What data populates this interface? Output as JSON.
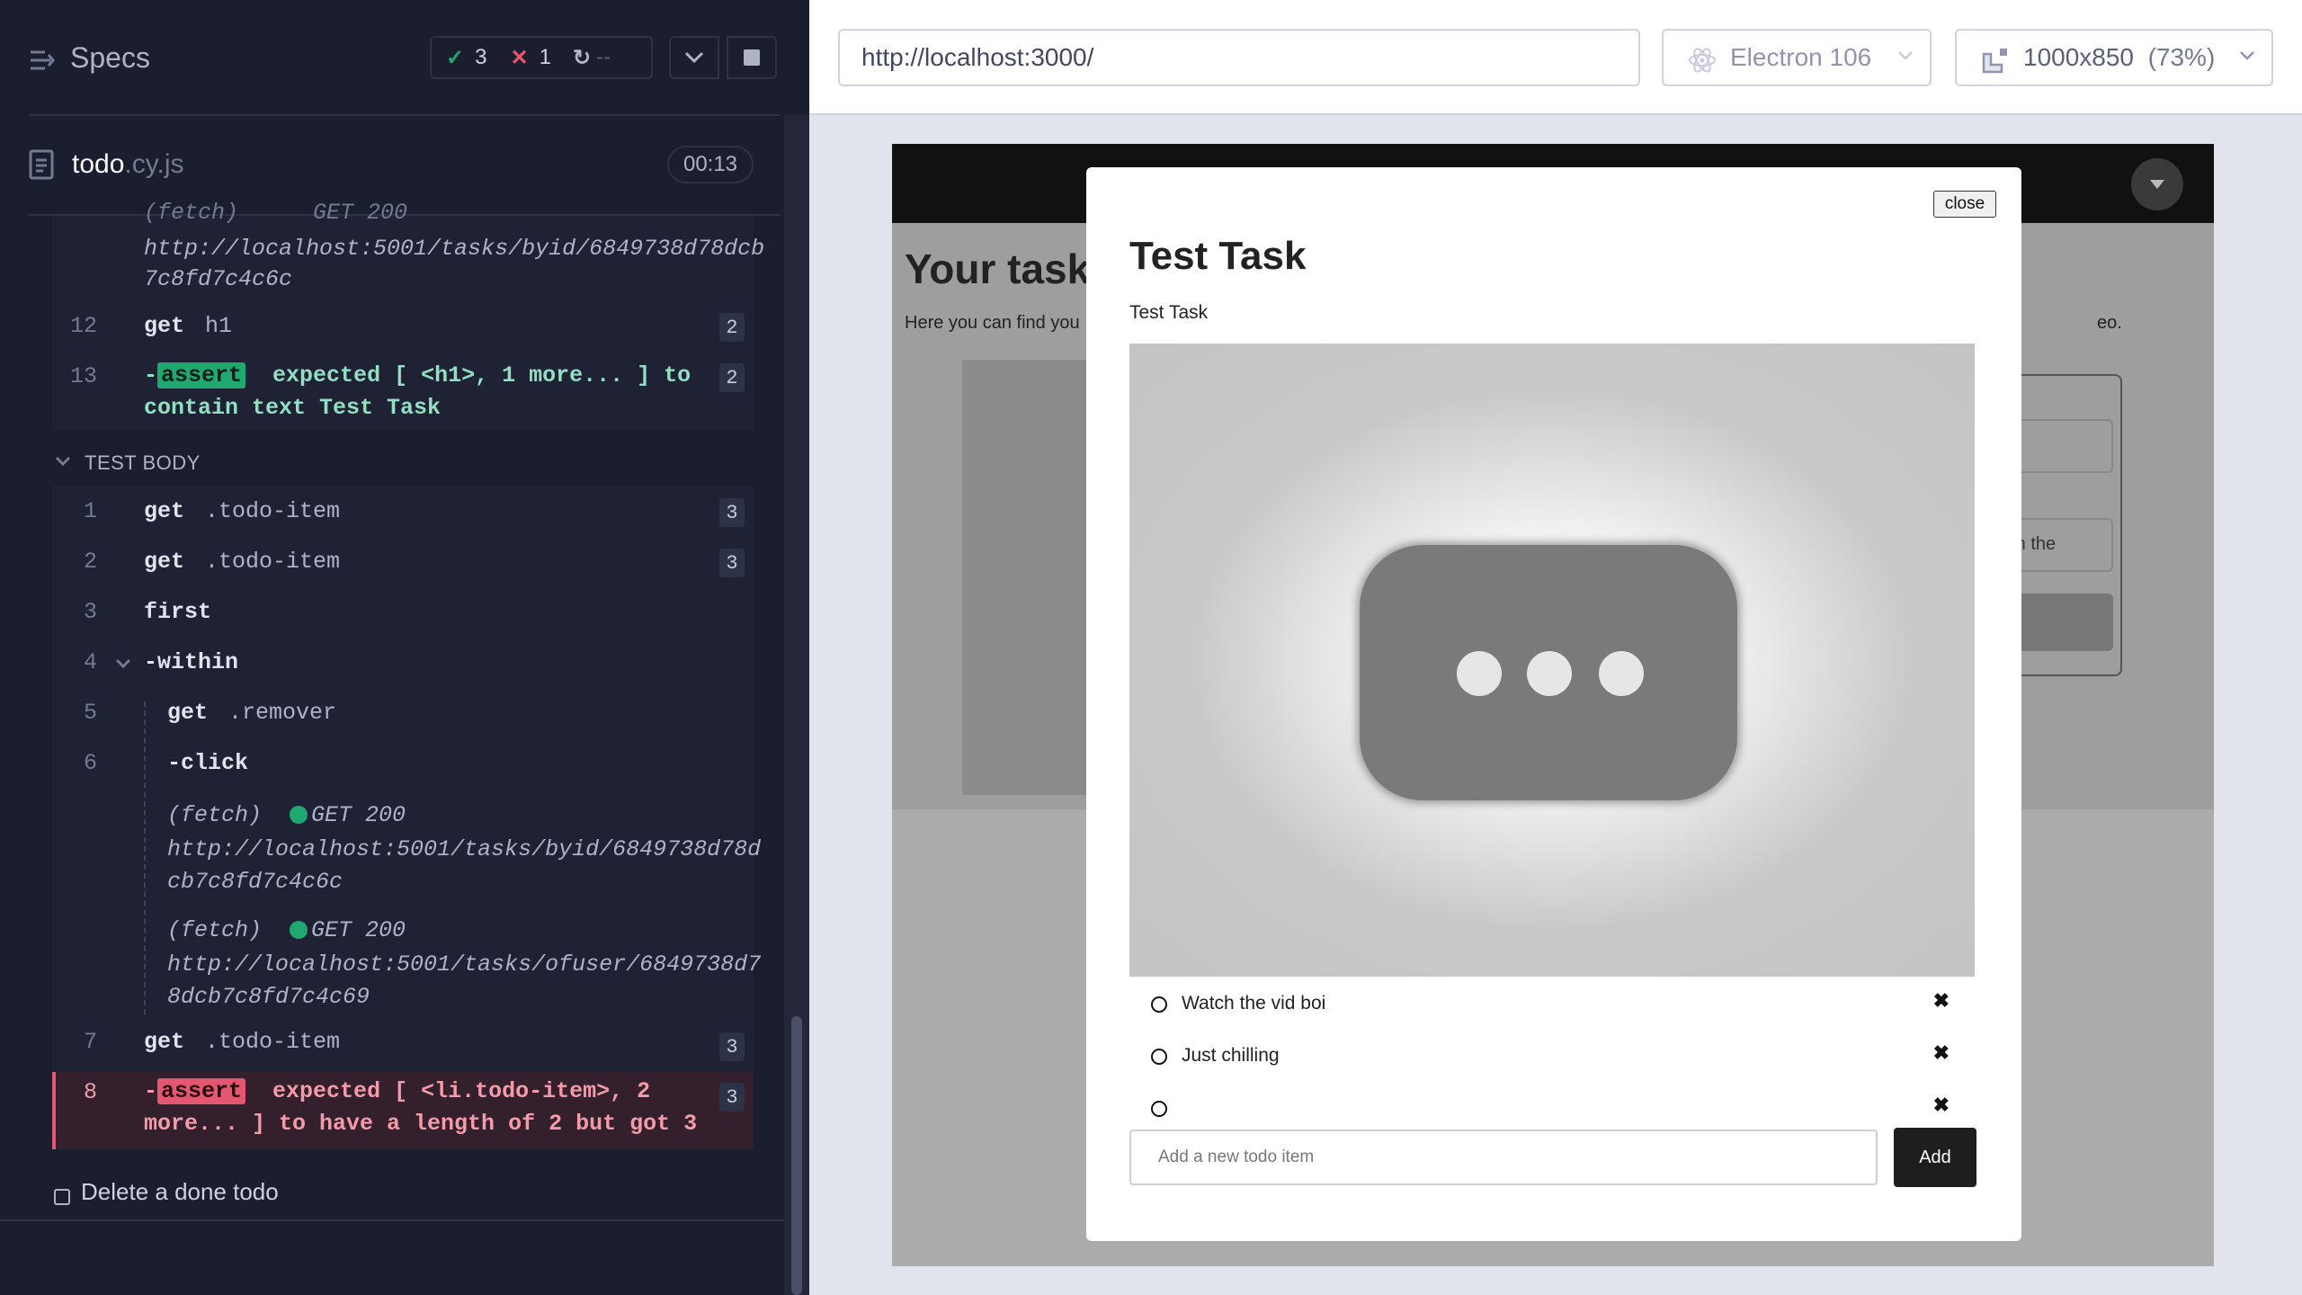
{
  "specs": {
    "title": "Specs",
    "passed": "3",
    "failed": "1",
    "pending": "--"
  },
  "file": {
    "name": "todo",
    "ext": ".cy.js",
    "duration": "00:13"
  },
  "log_before": {
    "fetch_partial": "(fetch)",
    "get200_partial": "GET 200",
    "url_line1": "http://localhost:5001/tasks/byid/6849738d78dcb",
    "url_line2": "7c8fd7c4c6c",
    "l12_num": "12",
    "l12_cmd": "get",
    "l12_arg": "h1",
    "l12_badge": "2",
    "l13_num": "13",
    "l13_dash": "-",
    "l13_assert": "assert",
    "l13_text1": "expected [ <h1>, 1 more... ] to",
    "l13_text2": "contain text  Test Task",
    "l13_badge": "2"
  },
  "test_body": {
    "label": "TEST BODY",
    "lines": [
      {
        "num": "1",
        "cmd": "get",
        "arg": ".todo-item",
        "badge": "3"
      },
      {
        "num": "2",
        "cmd": "get",
        "arg": ".todo-item",
        "badge": "3"
      },
      {
        "num": "3",
        "cmd": "first",
        "arg": "",
        "badge": ""
      },
      {
        "num": "4",
        "cmd": "-within",
        "arg": "",
        "badge": ""
      },
      {
        "num": "5",
        "cmd": "get",
        "arg": ".remover",
        "badge": ""
      },
      {
        "num": "6",
        "cmd": "-click",
        "arg": "",
        "badge": ""
      }
    ],
    "fetch1": {
      "label": "(fetch)",
      "status": "GET 200",
      "url1": "http://localhost:5001/tasks/byid/6849738d78d",
      "url2": "cb7c8fd7c4c6c"
    },
    "fetch2": {
      "label": "(fetch)",
      "status": "GET 200",
      "url1": "http://localhost:5001/tasks/ofuser/6849738d7",
      "url2": "8dcb7c8fd7c4c69"
    },
    "l7": {
      "num": "7",
      "cmd": "get",
      "arg": ".todo-item",
      "badge": "3"
    },
    "l8": {
      "num": "8",
      "dash": "-",
      "assert": "assert",
      "text1": "expected [ <li.todo-item>, 2",
      "text2": "more... ] to have a length of  2  but got  3",
      "badge": "3"
    }
  },
  "next_test": "Delete a done todo",
  "browser_bar": {
    "url": "http://localhost:3000/",
    "browser": "Electron 106",
    "viewport": "1000x850",
    "zoom": "(73%)"
  },
  "app": {
    "page_heading": "Your tasks",
    "page_text_left": "Here you can find you",
    "page_text_right": "eo.",
    "form_hint": "= in the",
    "modal": {
      "close_label": "close",
      "title": "Test Task",
      "subtitle": "Test Task",
      "todos": [
        {
          "text": "Watch the vid boi"
        },
        {
          "text": "Just chilling"
        },
        {
          "text": ""
        }
      ],
      "remove_glyph": "✖",
      "add_placeholder": "Add a new todo item",
      "add_label": "Add"
    }
  },
  "colors": {
    "panel_bg": "#1b1e2e",
    "pass": "#1fa971",
    "fail": "#e45770"
  }
}
